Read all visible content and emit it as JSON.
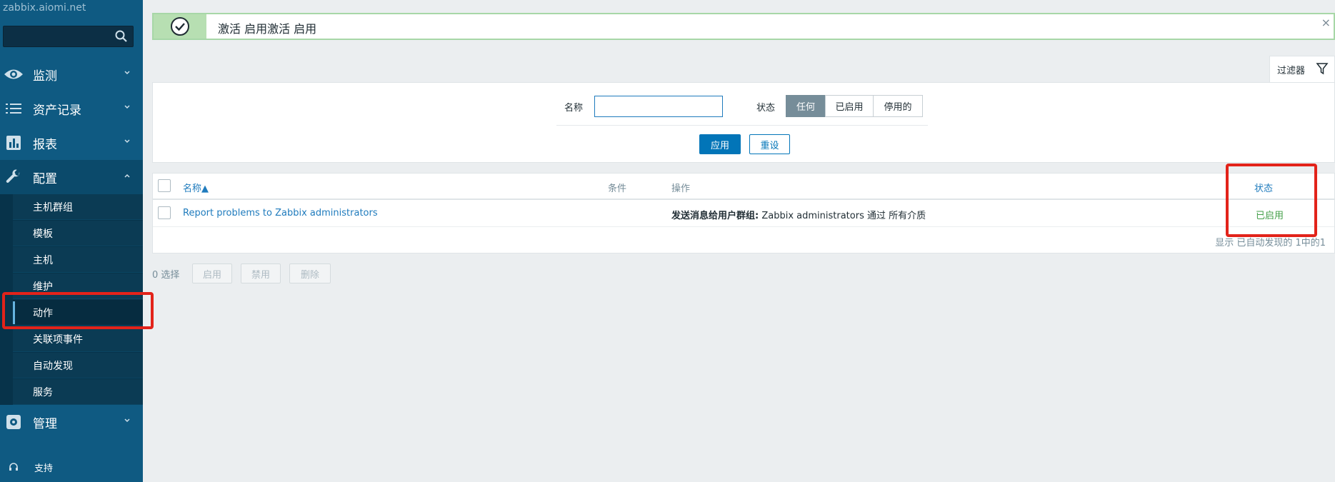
{
  "sidebar": {
    "brand": "zabbix.aiomi.net",
    "search_placeholder": "",
    "items": [
      {
        "label": "监测",
        "icon": "eye-icon"
      },
      {
        "label": "资产记录",
        "icon": "list-icon"
      },
      {
        "label": "报表",
        "icon": "bar-chart-icon"
      },
      {
        "label": "配置",
        "icon": "wrench-icon"
      },
      {
        "label": "管理",
        "icon": "gear-icon"
      }
    ],
    "config_sub": [
      "主机群组",
      "模板",
      "主机",
      "维护",
      "动作",
      "关联项事件",
      "自动发现",
      "服务"
    ],
    "support": "支持"
  },
  "alert": {
    "message": "激活 启用激活 启用",
    "close": "×"
  },
  "filter": {
    "tab_label": "过滤器",
    "name_label": "名称",
    "name_value": "",
    "status_label": "状态",
    "status_options": [
      "任何",
      "已启用",
      "停用的"
    ],
    "status_selected": "任何",
    "apply": "应用",
    "reset": "重设"
  },
  "table": {
    "headers": {
      "name": "名称▲",
      "conditions": "条件",
      "operations": "操作",
      "status": "状态"
    },
    "rows": [
      {
        "name": "Report problems to Zabbix administrators",
        "conditions": "",
        "operations_bold": "发送消息给用户群组:",
        "operations_rest": " Zabbix administrators 通过 所有介质",
        "status": "已启用"
      }
    ],
    "footer": "显示 已自动发现的 1中的1"
  },
  "actions": {
    "selected": "0 选择",
    "enable": "启用",
    "disable": "禁用",
    "delete": "删除"
  },
  "colors": {
    "sidebar": "#0f5a82",
    "accent": "#0275b8",
    "success": "#429e47",
    "highlight": "#e2231a"
  }
}
